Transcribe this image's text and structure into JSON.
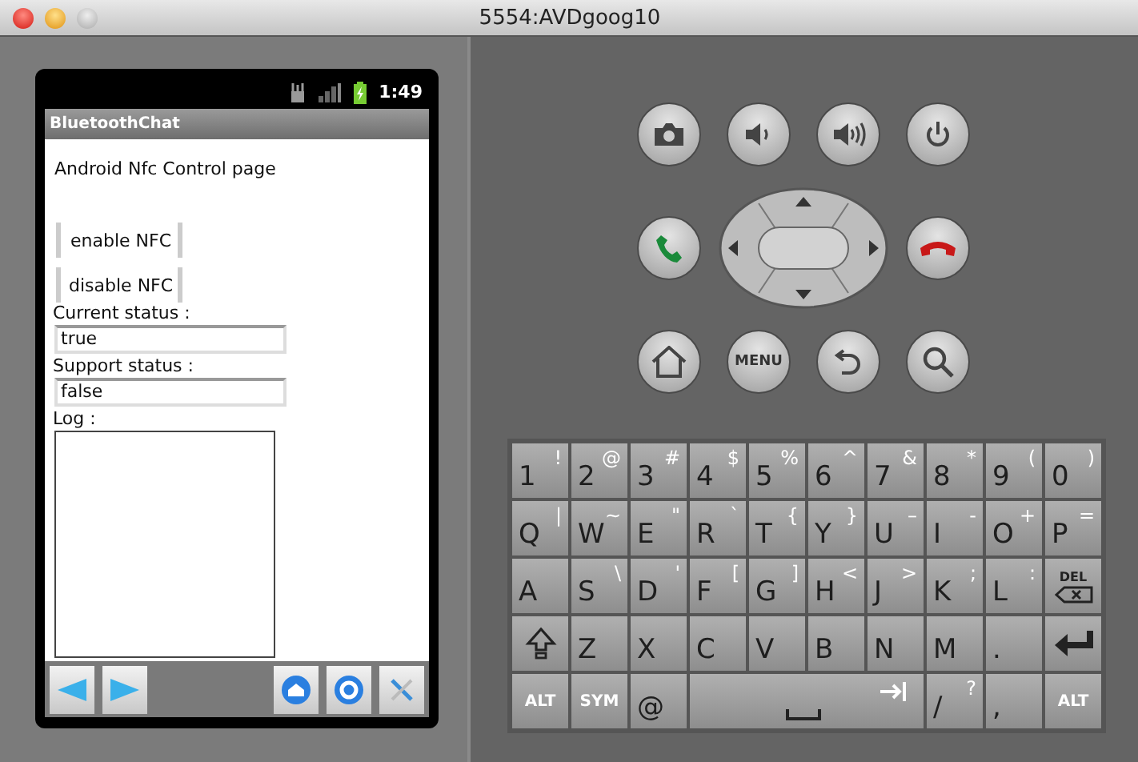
{
  "window": {
    "title": "5554:AVDgoog10"
  },
  "phone": {
    "status_bar": {
      "time": "1:49"
    },
    "app_title": "BluetoothChat",
    "heading": "Android Nfc Control page",
    "buttons": [
      "enable NFC",
      "disable NFC"
    ],
    "fields": [
      {
        "label": "Current status :",
        "value": "true"
      },
      {
        "label": "Support status :",
        "value": "false"
      }
    ],
    "log": {
      "label": "Log :"
    }
  },
  "hardware": {
    "menu_label": "MENU"
  },
  "keyboard": {
    "rows": [
      [
        {
          "kind": "char",
          "main": "1",
          "alt": "!"
        },
        {
          "kind": "char",
          "main": "2",
          "alt": "@"
        },
        {
          "kind": "char",
          "main": "3",
          "alt": "#"
        },
        {
          "kind": "char",
          "main": "4",
          "alt": "$"
        },
        {
          "kind": "char",
          "main": "5",
          "alt": "%"
        },
        {
          "kind": "char",
          "main": "6",
          "alt": "^"
        },
        {
          "kind": "char",
          "main": "7",
          "alt": "&"
        },
        {
          "kind": "char",
          "main": "8",
          "alt": "*"
        },
        {
          "kind": "char",
          "main": "9",
          "alt": "("
        },
        {
          "kind": "char",
          "main": "0",
          "alt": ")"
        }
      ],
      [
        {
          "kind": "char",
          "main": "Q",
          "alt": "|"
        },
        {
          "kind": "char",
          "main": "W",
          "alt": "~"
        },
        {
          "kind": "char",
          "main": "E",
          "alt": "\""
        },
        {
          "kind": "char",
          "main": "R",
          "alt": "`"
        },
        {
          "kind": "char",
          "main": "T",
          "alt": "{"
        },
        {
          "kind": "char",
          "main": "Y",
          "alt": "}"
        },
        {
          "kind": "char",
          "main": "U",
          "alt": "–"
        },
        {
          "kind": "char",
          "main": "I",
          "alt": "-"
        },
        {
          "kind": "char",
          "main": "O",
          "alt": "+"
        },
        {
          "kind": "char",
          "main": "P",
          "alt": "="
        }
      ],
      [
        {
          "kind": "char",
          "main": "A"
        },
        {
          "kind": "char",
          "main": "S",
          "alt": "\\"
        },
        {
          "kind": "char",
          "main": "D",
          "alt": "'"
        },
        {
          "kind": "char",
          "main": "F",
          "alt": "["
        },
        {
          "kind": "char",
          "main": "G",
          "alt": "]"
        },
        {
          "kind": "char",
          "main": "H",
          "alt": "<"
        },
        {
          "kind": "char",
          "main": "J",
          "alt": ">"
        },
        {
          "kind": "char",
          "main": "K",
          "alt": ";"
        },
        {
          "kind": "char",
          "main": "L",
          "alt": ":"
        },
        {
          "kind": "del",
          "main": "DEL"
        }
      ],
      [
        {
          "kind": "shift"
        },
        {
          "kind": "char",
          "main": "Z"
        },
        {
          "kind": "char",
          "main": "X"
        },
        {
          "kind": "char",
          "main": "C"
        },
        {
          "kind": "char",
          "main": "V"
        },
        {
          "kind": "char",
          "main": "B"
        },
        {
          "kind": "char",
          "main": "N"
        },
        {
          "kind": "char",
          "main": "M"
        },
        {
          "kind": "char",
          "main": "."
        },
        {
          "kind": "enter"
        }
      ],
      [
        {
          "kind": "mod",
          "main": "ALT"
        },
        {
          "kind": "mod",
          "main": "SYM"
        },
        {
          "kind": "char",
          "main": "@"
        },
        {
          "kind": "space"
        },
        "",
        "",
        "",
        {
          "kind": "char",
          "main": "/",
          "alt": "?"
        },
        {
          "kind": "char",
          "main": ","
        },
        {
          "kind": "mod",
          "main": "ALT"
        }
      ]
    ]
  }
}
